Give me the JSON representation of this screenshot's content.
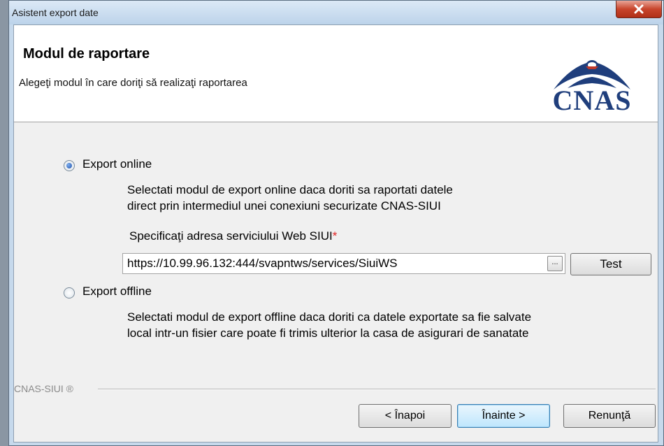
{
  "window": {
    "title": "Asistent export date",
    "close_label": "x"
  },
  "header": {
    "title": "Modul de raportare",
    "subtitle": "Alegeţi modul în care doriţi să realizaţi raportarea",
    "logo_text": "CNAS"
  },
  "options": {
    "online": {
      "label": "Export online",
      "selected": true,
      "desc_line1": "Selectati modul de export online daca doriti sa raportati datele",
      "desc_line2": "direct prin intermediul unei conexiuni securizate CNAS-SIUI"
    },
    "offline": {
      "label": "Export offline",
      "selected": false,
      "desc_line1": "Selectati modul de export offline daca doriti ca datele exportate sa fie salvate",
      "desc_line2": "local intr-un fisier care poate fi trimis ulterior la casa de asigurari de sanatate"
    }
  },
  "webservice": {
    "label": "Specificaţi adresa serviciului Web SIUI",
    "required_mark": "*",
    "url": "https://10.99.96.132:444/svapntws/services/SiuiWS",
    "browse_label": "...",
    "test_label": "Test"
  },
  "footer": {
    "brand": "CNAS-SIUI ®"
  },
  "buttons": {
    "back": "< Înapoi",
    "next": "Înainte >",
    "cancel": "Renunţă"
  },
  "colors": {
    "logo_blue": "#1f3e7c",
    "close_red": "#c8452c",
    "required_red": "#e02020"
  }
}
